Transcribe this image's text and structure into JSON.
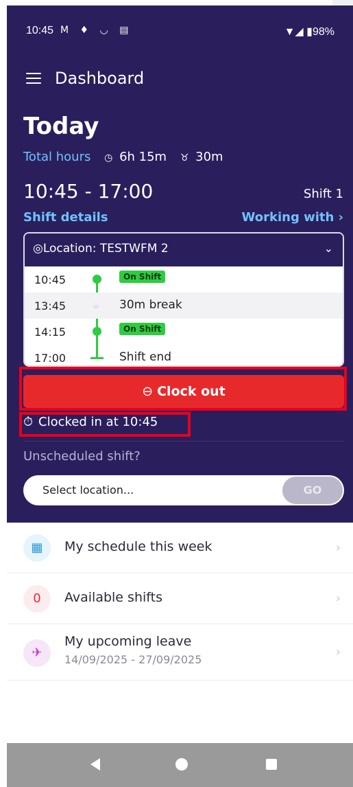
{
  "status_bar": {
    "time": "10:45",
    "left_icons": "M ♦ ◡ ▤",
    "right": "▼◢ ▮98%"
  },
  "appbar": {
    "title": "Dashboard"
  },
  "today": {
    "heading": "Today",
    "total_hours_label": "Total hours",
    "hours_icon": "◷",
    "hours_value": "6h 15m",
    "break_icon": "♉",
    "break_value": "30m",
    "shift_time": "10:45 - 17:00",
    "shift_label": "Shift 1",
    "shift_details_link": "Shift details",
    "working_with_link": "Working with ›"
  },
  "location": {
    "label": "◎Location: TESTWFM 2",
    "chevron": "⌄",
    "timeline": [
      {
        "time": "10:45",
        "badge": "On Shift",
        "text": ""
      },
      {
        "time": "13:45",
        "badge": "",
        "text": "30m break"
      },
      {
        "time": "14:15",
        "badge": "On Shift",
        "text": ""
      },
      {
        "time": "17:00",
        "badge": "",
        "text": "Shift end"
      }
    ]
  },
  "clock_out": {
    "icon": "⊖",
    "label": "Clock out"
  },
  "clocked_in": {
    "icon": "⏱",
    "label": "Clocked in at 10:45"
  },
  "unscheduled": {
    "label": "Unscheduled shift?",
    "placeholder": "Select location...",
    "go_label": "GO"
  },
  "list": [
    {
      "icon": "▦",
      "title": "My schedule this week",
      "sub": "",
      "icon_bg": "#e6f4fc",
      "icon_color": "#2a9ad6"
    },
    {
      "icon": "0",
      "title": "Available shifts",
      "sub": "",
      "icon_bg": "#fdecee",
      "icon_color": "#e8292b"
    },
    {
      "icon": "✈",
      "title": "My upcoming leave",
      "sub": "14/09/2025 - 27/09/2025",
      "icon_bg": "#f6e6f8",
      "icon_color": "#c13ccf"
    }
  ],
  "chevron": "›"
}
